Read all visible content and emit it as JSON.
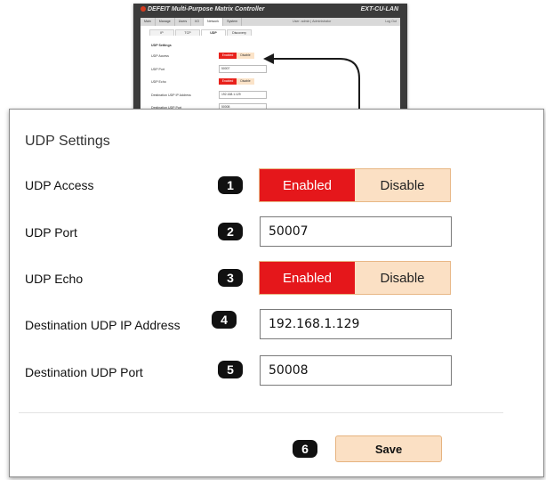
{
  "thumbnail": {
    "brand": "DEFEIT Multi-Purpose Matrix Controller",
    "model": "EXT-CU-LAN",
    "nav": [
      "Main",
      "Manage",
      "Users",
      "I/O",
      "Network",
      "System"
    ],
    "active_nav": "Network",
    "user": "User: admin  |  Administrator",
    "logout": "Log Out",
    "tabs": [
      "IP",
      "TCP",
      "UDP",
      "Discovery"
    ],
    "active_tab": "UDP",
    "section": "UDP Settings",
    "rows": [
      "UDP Access",
      "UDP Port",
      "UDP Echo",
      "Destination UDP IP Address",
      "Destination UDP Port"
    ],
    "enabled": "Enabled",
    "disable": "Disable",
    "port": "50007",
    "ip": "192.168.1.129",
    "dest_port": "50008"
  },
  "panel": {
    "title": "UDP Settings",
    "udp_access": {
      "label": "UDP Access",
      "badge": "1",
      "enabled_label": "Enabled",
      "disable_label": "Disable",
      "selected": "Enabled"
    },
    "udp_port": {
      "label": "UDP Port",
      "badge": "2",
      "value": "50007"
    },
    "udp_echo": {
      "label": "UDP Echo",
      "badge": "3",
      "enabled_label": "Enabled",
      "disable_label": "Disable",
      "selected": "Enabled"
    },
    "dest_ip": {
      "label": "Destination UDP IP Address",
      "badge": "4",
      "value": "192.168.1.129"
    },
    "dest_port": {
      "label": "Destination UDP Port",
      "badge": "5",
      "value": "50008"
    },
    "save": {
      "badge": "6",
      "label": "Save"
    }
  },
  "colors": {
    "enabled_red": "#e5171b",
    "disable_peach": "#fbe0c4",
    "badge_black": "#111111"
  }
}
